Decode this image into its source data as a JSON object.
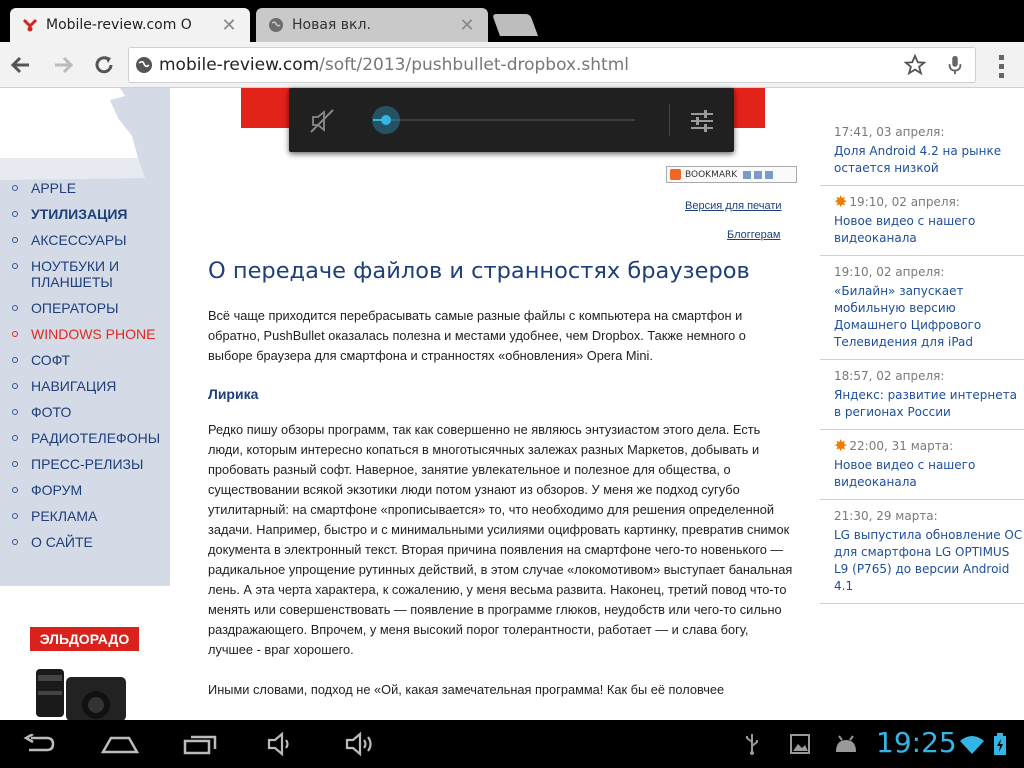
{
  "tabs": [
    {
      "title": "Mobile-review.com О",
      "icon": "mobile-review-favicon",
      "active": true
    },
    {
      "title": "Новая вкл.",
      "icon": "globe-icon",
      "active": false
    }
  ],
  "toolbar": {
    "url_host": "mobile-review.com",
    "url_path": "/soft/2013/pushbullet-dropbox.shtml"
  },
  "sidebar": {
    "items": [
      {
        "label": "APPLE",
        "style": "normal"
      },
      {
        "label": "УТИЛИЗАЦИЯ",
        "style": "bold"
      },
      {
        "label": "АКСЕССУАРЫ",
        "style": "normal"
      },
      {
        "label": "НОУТБУКИ И ПЛАНШЕТЫ",
        "style": "normal"
      },
      {
        "label": "ОПЕРАТОРЫ",
        "style": "normal"
      },
      {
        "label": "WINDOWS PHONE",
        "style": "red"
      },
      {
        "label": "СОФТ",
        "style": "normal"
      },
      {
        "label": "НАВИГАЦИЯ",
        "style": "normal"
      },
      {
        "label": "ФОТО",
        "style": "normal"
      },
      {
        "label": "РАДИОТЕЛЕФОНЫ",
        "style": "normal"
      },
      {
        "label": "ПРЕСС-РЕЛИЗЫ",
        "style": "normal"
      },
      {
        "label": "ФОРУМ",
        "style": "normal"
      },
      {
        "label": "РЕКЛАМА",
        "style": "normal"
      },
      {
        "label": "О САЙТЕ",
        "style": "normal"
      }
    ],
    "ad_logo": "ЭЛЬДОРАДО"
  },
  "bookmark_label": "BOOKMARK",
  "print_link": "Версия для печати",
  "bloggers_link": "Блоггерам",
  "article": {
    "title": "О передаче файлов и странностях браузеров",
    "intro": "Всё чаще приходится перебрасывать самые разные файлы с компьютера на смартфон и обратно, PushBullet оказалась полезна и местами удобнее, чем Dropbox. Также немного о выборе браузера для смартфона и странностях «обновления» Opera Mini.",
    "section_heading": "Лирика",
    "body": "Редко пишу обзоры программ, так как совершенно не являюсь энтузиастом этого дела. Есть люди, которым интересно копаться в многотысячных залежах разных Маркетов, добывать и пробовать разный софт. Наверное, занятие увлекательное и полезное для общества, о существовании всякой экзотики люди потом узнают из обзоров. У меня же подход сугубо утилитарный: на смартфоне «прописывается» то, что необходимо для решения определенной задачи. Например, быстро и с минимальными усилиями оцифровать картинку, превратив снимок документа в электронный текст. Вторая причина появления на смартфоне чего-то новенького — радикальное упрощение рутинных действий, в этом случае «локомотивом» выступает банальная лень. А эта черта характера, к сожалению, у меня весьма развита. Наконец, третий повод что-то менять или совершенствовать — появление в программе глюков, неудобств или чего-то сильно раздражающего. Впрочем, у меня высокий порог толерантности, работает — и слава богу, лучшее - враг хорошего.",
    "continuation": "Иными словами, подход не «Ой, какая замечательная программа! Как бы её половчее"
  },
  "news": [
    {
      "time": "17:41, 03 апреля:",
      "starred": false,
      "headline": "Доля Android 4.2 на рынке остается низкой"
    },
    {
      "time": "19:10, 02 апреля:",
      "starred": true,
      "headline": "Новое видео с нашего видеоканала"
    },
    {
      "time": "19:10, 02 апреля:",
      "starred": false,
      "headline": "«Билайн» запускает мобильную версию Домашнего Цифрового Телевидения для iPad"
    },
    {
      "time": "18:57, 02 апреля:",
      "starred": false,
      "headline": "Яндекс: развитие интернета в регионах России"
    },
    {
      "time": "22:00, 31 марта:",
      "starred": true,
      "headline": "Новое видео с нашего видеоканала"
    },
    {
      "time": "21:30, 29 марта:",
      "starred": false,
      "headline": "LG выпустила обновление ОС для смартфона LG OPTIMUS L9 (P765) до версии Android 4.1"
    }
  ],
  "volume": {
    "level": 0.05,
    "muted": true
  },
  "sysbar": {
    "clock": "19:25",
    "accent": "#33b5e5"
  },
  "colors": {
    "link": "#1e3f7a",
    "accent_red": "#e0281e",
    "news_link": "#1e4f9a"
  }
}
